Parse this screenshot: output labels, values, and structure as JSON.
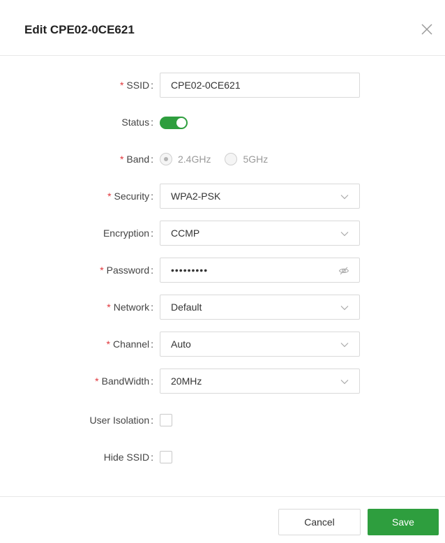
{
  "dialog": {
    "title": "Edit CPE02-0CE621"
  },
  "form": {
    "ssid": {
      "label": "SSID",
      "required": "*",
      "value": "CPE02-0CE621"
    },
    "status": {
      "label": "Status",
      "enabled": true
    },
    "band": {
      "label": "Band",
      "required": "*",
      "options": [
        "2.4GHz",
        "5GHz"
      ],
      "selected": "2.4GHz"
    },
    "security": {
      "label": "Security",
      "required": "*",
      "value": "WPA2-PSK"
    },
    "encryption": {
      "label": "Encryption",
      "value": "CCMP"
    },
    "password": {
      "label": "Password",
      "required": "*",
      "value": "•••••••••"
    },
    "network": {
      "label": "Network",
      "required": "*",
      "value": "Default"
    },
    "channel": {
      "label": "Channel",
      "required": "*",
      "value": "Auto"
    },
    "bandwidth": {
      "label": "BandWidth",
      "required": "*",
      "value": "20MHz"
    },
    "user_isolation": {
      "label": "User Isolation",
      "checked": false
    },
    "hide_ssid": {
      "label": "Hide SSID",
      "checked": false
    }
  },
  "footer": {
    "cancel_label": "Cancel",
    "save_label": "Save"
  },
  "colors": {
    "accent": "#2e9e3e",
    "required": "#e0363b"
  },
  "punctuation": {
    "colon": ":"
  },
  "icons": {
    "close": "close-icon",
    "dropdown": "chevron-down-icon",
    "password_toggle": "eye-off-icon"
  }
}
